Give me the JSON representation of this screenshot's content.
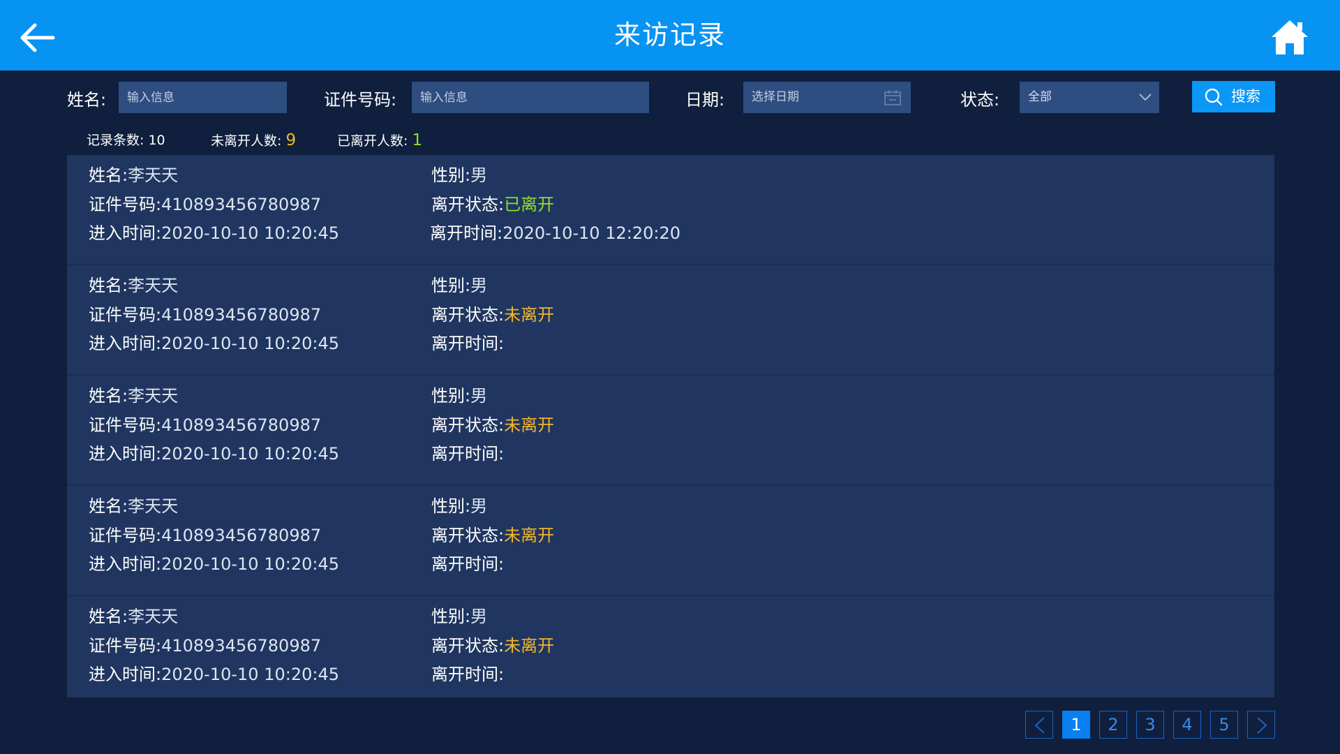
{
  "header": {
    "title": "来访记录"
  },
  "filters": {
    "name_label": "姓名:",
    "name_placeholder": "输入信息",
    "id_label": "证件号码:",
    "id_placeholder": "输入信息",
    "date_label": "日期:",
    "date_placeholder": "选择日期",
    "status_label": "状态:",
    "status_value": "全部",
    "search_label": "搜索"
  },
  "stats": {
    "records_label": "记录条数:",
    "records_value": "10",
    "not_left_label": "未离开人数:",
    "not_left_value": "9",
    "left_label": "已离开人数:",
    "left_value": "1"
  },
  "labels": {
    "name": "姓名:",
    "id": "证件号码:",
    "enter": "进入时间:",
    "gender": "性别:",
    "status": "离开状态:",
    "leave": "离开时间:"
  },
  "records": [
    {
      "name": "李天天",
      "id": "410893456780987",
      "enter": "2020-10-10 10:20:45",
      "gender": "男",
      "status": "已离开",
      "leave": "2020-10-10 12:20:20"
    },
    {
      "name": "李天天",
      "id": "410893456780987",
      "enter": "2020-10-10 10:20:45",
      "gender": "男",
      "status": "未离开",
      "leave": ""
    },
    {
      "name": "李天天",
      "id": "410893456780987",
      "enter": "2020-10-10 10:20:45",
      "gender": "男",
      "status": "未离开",
      "leave": ""
    },
    {
      "name": "李天天",
      "id": "410893456780987",
      "enter": "2020-10-10 10:20:45",
      "gender": "男",
      "status": "未离开",
      "leave": ""
    },
    {
      "name": "李天天",
      "id": "410893456780987",
      "enter": "2020-10-10 10:20:45",
      "gender": "男",
      "status": "未离开",
      "leave": ""
    }
  ],
  "pagination": {
    "pages": [
      "1",
      "2",
      "3",
      "4",
      "5"
    ],
    "current": "1"
  },
  "colors": {
    "header_bg": "#0793f2",
    "page_bg": "#0f1f3d",
    "panel_bg": "#203660",
    "input_bg": "#2e4d80",
    "left_status": "#8fe02a",
    "stay_status": "#f3b62d",
    "active_page": "#0a7ff0"
  },
  "icons": {
    "back": "arrow-left-icon",
    "home": "home-icon",
    "calendar": "calendar-icon",
    "dropdown": "chevron-down-icon",
    "search": "search-icon",
    "prev": "chevron-left-icon",
    "next": "chevron-right-icon"
  }
}
